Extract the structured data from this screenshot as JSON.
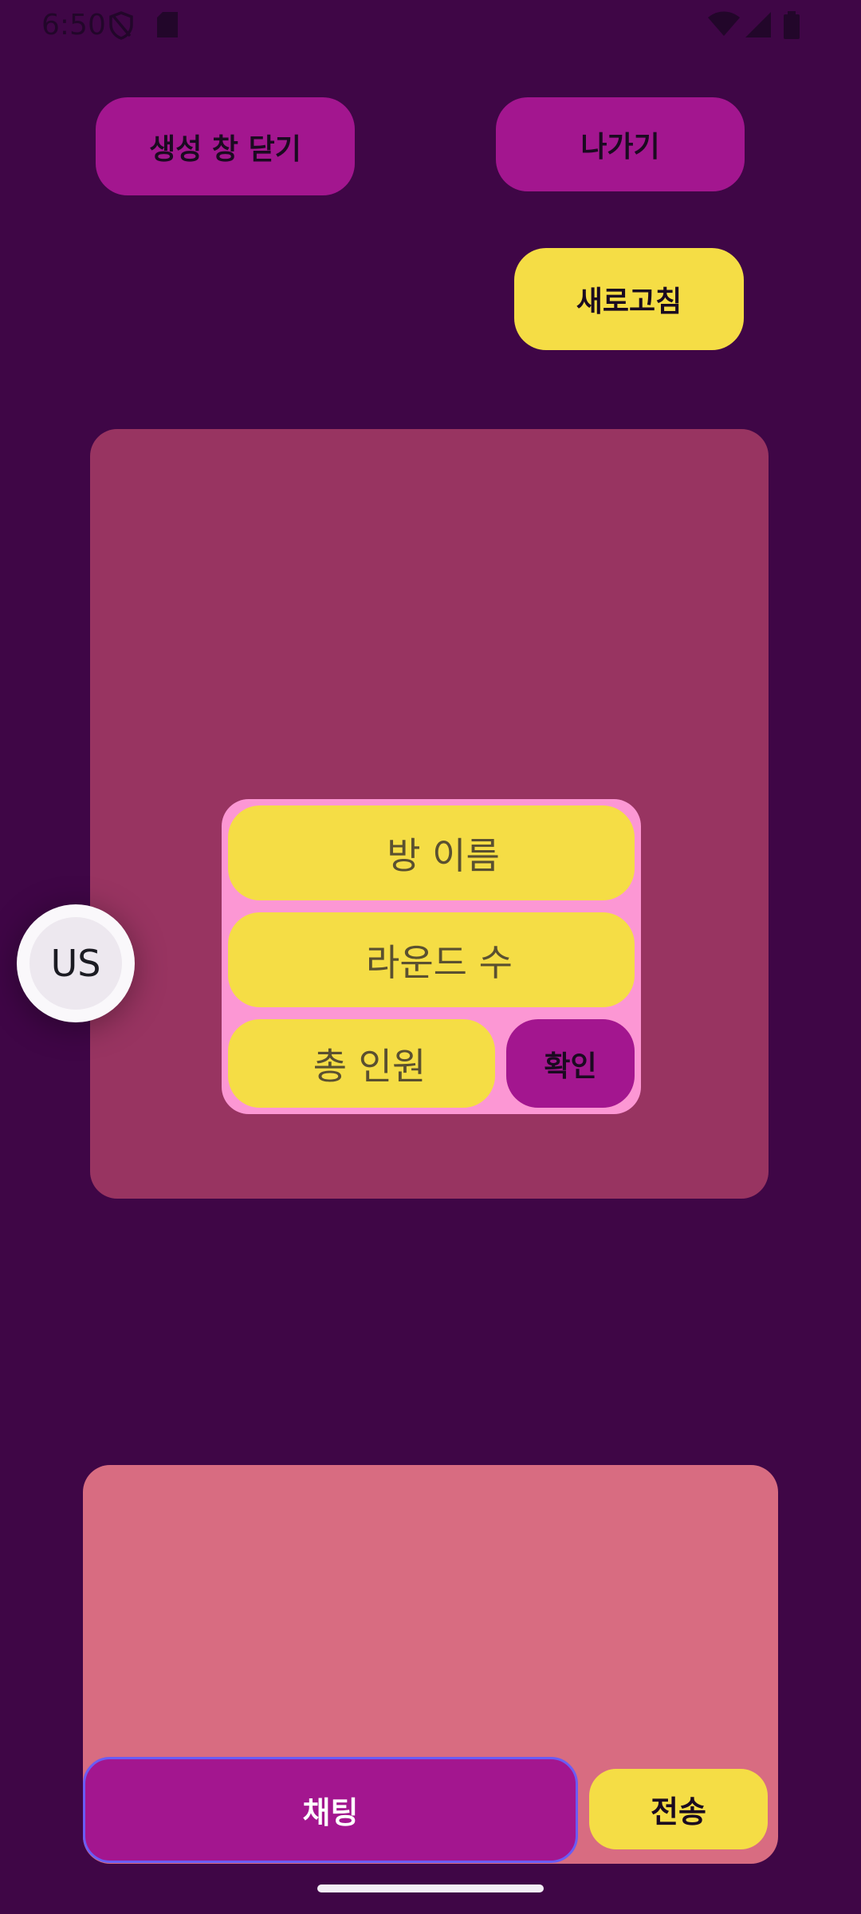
{
  "status_bar": {
    "time": "6:50"
  },
  "top_actions": {
    "close_create": "생성 창 닫기",
    "exit": "나가기",
    "refresh": "새로고침"
  },
  "create_room_dialog": {
    "room_name": "방 이름",
    "rounds": "라운드 수",
    "total_players": "총 인원",
    "confirm": "확인"
  },
  "avatar": {
    "initials": "US"
  },
  "chat": {
    "input_label": "채팅",
    "send": "전송"
  },
  "colors": {
    "background": "#3f0646",
    "magenta": "#a3168f",
    "yellow": "#f5dd45",
    "room_panel": "#983461",
    "dialog": "#fc97d4",
    "chat_panel": "#d86c81"
  }
}
